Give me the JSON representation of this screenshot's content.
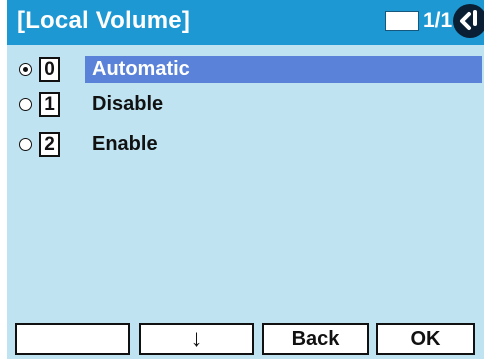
{
  "header": {
    "title": "[Local Volume]",
    "page_count": "1/1",
    "nav_icon": "back-arrow-icon"
  },
  "menu": {
    "items": [
      {
        "key": "0",
        "label": "Automatic",
        "radio_selected": true,
        "highlighted": true
      },
      {
        "key": "1",
        "label": "Disable",
        "radio_selected": false,
        "highlighted": false
      },
      {
        "key": "2",
        "label": "Enable",
        "radio_selected": false,
        "highlighted": false
      }
    ]
  },
  "softkeys": {
    "key1": "",
    "key2": "↓",
    "key3": "Back",
    "key4": "OK"
  },
  "colors": {
    "background": "#bfe3f0",
    "titlebar": "#1d98d3",
    "highlight": "#5a82d8"
  }
}
